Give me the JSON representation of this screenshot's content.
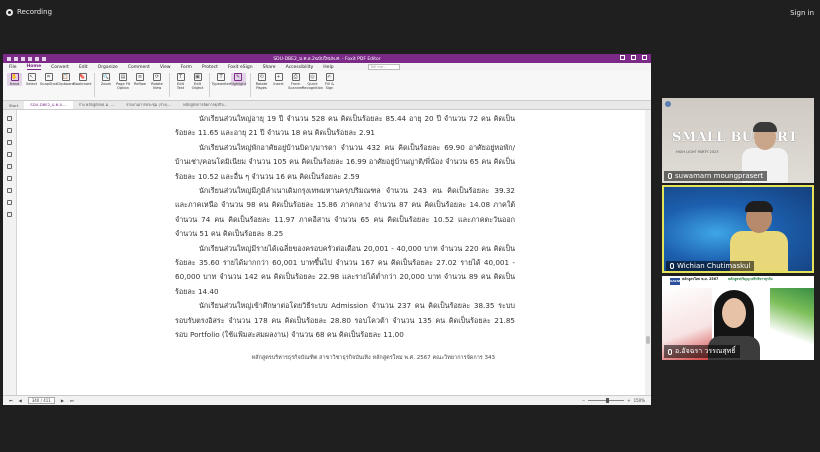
{
  "meeting": {
    "recording_label": "Recording",
    "signin_label": "Sign in"
  },
  "app": {
    "title": "SDU-DBE2_ม.ค.อ.2ฉบับใหม่พ.ศ. - Foxit PDF Editor",
    "menu": [
      "File",
      "Home",
      "Convert",
      "Edit",
      "Organize",
      "Comment",
      "View",
      "Form",
      "Protect",
      "Foxit eSign",
      "Share",
      "Accessibility",
      "Help"
    ],
    "active_menu": "Home",
    "search_placeholder": "Tell me...",
    "ribbon": [
      {
        "label": "Hand",
        "icon": "hand-icon"
      },
      {
        "label": "Select",
        "icon": "cursor-icon"
      },
      {
        "label": "SnapShot",
        "icon": "camera-icon"
      },
      {
        "label": "Clipboard",
        "icon": "clipboard-icon"
      },
      {
        "label": "Bookmark",
        "icon": "bookmark-icon"
      },
      {
        "label": "Zoom",
        "icon": "zoom-icon"
      },
      {
        "label": "Page Fit Option",
        "icon": "page-fit-icon"
      },
      {
        "label": "Reflow",
        "icon": "reflow-icon"
      },
      {
        "label": "Rotate View",
        "icon": "rotate-view-icon"
      },
      {
        "label": "Edit Text",
        "icon": "edit-text-icon"
      },
      {
        "label": "Edit Object",
        "icon": "edit-object-icon"
      },
      {
        "label": "Typewriter",
        "icon": "typewriter-icon"
      },
      {
        "label": "Highlight",
        "icon": "highlight-icon"
      },
      {
        "label": "Rotate Pages",
        "icon": "rotate-pages-icon"
      },
      {
        "label": "Insert",
        "icon": "insert-icon"
      },
      {
        "label": "From Scanner",
        "icon": "scanner-icon"
      },
      {
        "label": "Quick Recognition",
        "icon": "ocr-icon"
      },
      {
        "label": "Fill & Sign",
        "icon": "sign-icon"
      }
    ],
    "tabs": [
      "Start",
      "SDU-DBE2_ม.ค.อ....",
      "ร่าง หลักสูตรบธ.ม. ...",
      "รายงานการประชุม (ร่าง)...",
      "หลักสูตรการจัดการธุรกิจ..."
    ],
    "current_tab_index": 1,
    "status": {
      "page_indicator": "340 / 411",
      "zoom": "150%"
    }
  },
  "document": {
    "paragraphs": [
      "นักเรียนส่วนใหญ่อายุ 19 ปี จำนวน 528 คน คิดเป็นร้อยละ 85.44 อายุ 20 ปี จำนวน 72 คน คิดเป็นร้อยละ 11.65 และอายุ 21 ปี จำนวน 18 คน คิดเป็นร้อยละ 2.91",
      "นักเรียนส่วนใหญ่พักอาศัยอยู่บ้านบิดา/มารดา จำนวน 432 คน คิดเป็นร้อยละ 69.90 อาศัยอยู่หอพัก/บ้านเช่า/คอนโดมิเนียม จำนวน 105 คน คิดเป็นร้อยละ 16.99 อาศัยอยู่บ้านญาติ/พี่น้อง จำนวน 65 คน คิดเป็นร้อยละ 10.52 และอื่น ๆ จำนวน 16 คน คิดเป็นร้อยละ 2.59",
      "นักเรียนส่วนใหญ่มีภูมิลำเนาเดิมกรุงเทพมหานคร/ปริมณฑล จำนวน 243 คน คิดเป็นร้อยละ 39.32 และภาคเหนือ จำนวน 98 คน คิดเป็นร้อยละ 15.86 ภาคกลาง จำนวน 87 คน คิดเป็นร้อยละ 14.08 ภาคใต้ จำนวน 74 คน คิดเป็นร้อยละ 11.97 ภาคอีสาน จำนวน 65 คน คิดเป็นร้อยละ 10.52 และภาคตะวันออก จำนวน 51 คน คิดเป็นร้อยละ 8.25",
      "นักเรียนส่วนใหญ่มีรายได้เฉลี่ยของครอบครัวต่อเดือน 20,001 - 40,000 บาท จำนวน 220 คน คิดเป็นร้อยละ 35.60 รายได้มากกว่า 60,001 บาทขึ้นไป จำนวน 167 คน คิดเป็นร้อยละ 27.02 รายได้ 40,001 - 60,000 บาท จำนวน 142 คน คิดเป็นร้อยละ 22.98 และรายได้ต่ำกว่า 20,000 บาท จำนวน 89 คน คิดเป็นร้อยละ 14.40",
      "นักเรียนส่วนใหญ่เข้าศึกษาต่อโดยวิธีระบบ Admission จำนวน 237 คน คิดเป็นร้อยละ 38.35 ระบบรอบรับตรงอิสระ จำนวน 178 คน คิดเป็นร้อยละ 28.80 รอบโควต้า จำนวน 135 คน คิดเป็นร้อยละ 21.85 รอบ Portfolio (ใช้แฟ้มสะสมผลงาน) จำนวน 68 คน คิดเป็นร้อยละ 11.00"
    ],
    "footer": "หลักสูตรบริหารธุรกิจบัณฑิต สาขาวิชาธุรกิจบันเทิง หลักสูตรใหม่ พ.ศ. 2567 คณะวิทยาการจัดการ   343"
  },
  "participants": [
    {
      "name": "suwamarn moungprasert",
      "banner": "SMALL BU...ART",
      "banner_sub": "HIGH LIGHT PARTY 2023"
    },
    {
      "name": "Wichian Chutimaskul",
      "active_speaker": true
    },
    {
      "name": "อ.อัจฉรา วรรณสุทธิ์",
      "badge_org": "AACSB",
      "badge_text": "หลักสูตรใหม่ พ.ศ. 2567",
      "badge_text2": "หลักสูตรปริญญาตรีบริหารธุรกิจ"
    }
  ],
  "colors": {
    "foxit_purple": "#7b2a88",
    "speaker_highlight": "#e5e35a"
  }
}
